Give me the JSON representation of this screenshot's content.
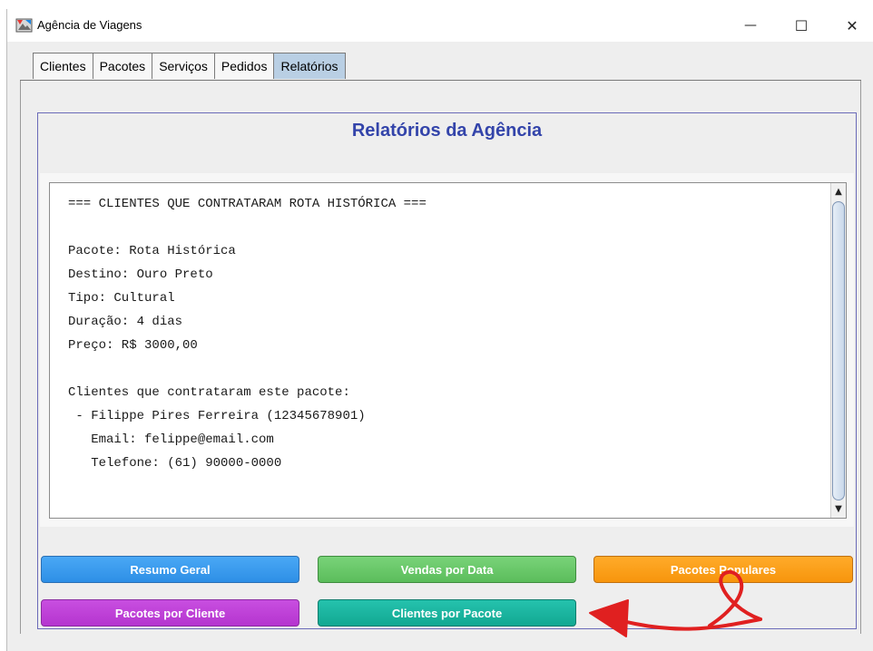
{
  "window": {
    "title": "Agência de Viagens",
    "minimize_glyph": "—",
    "maximize_glyph": "☐",
    "close_glyph": "✕",
    "icon": "app-icon"
  },
  "tabs": [
    {
      "label": "Clientes",
      "active": false
    },
    {
      "label": "Pacotes",
      "active": false
    },
    {
      "label": "Serviços",
      "active": false
    },
    {
      "label": "Pedidos",
      "active": false
    },
    {
      "label": "Relatórios",
      "active": true
    }
  ],
  "panel": {
    "title": "Relatórios da Agência"
  },
  "report": {
    "lines": [
      "=== CLIENTES QUE CONTRATARAM ROTA HISTÓRICA ===",
      "",
      "Pacote: Rota Histórica",
      "Destino: Ouro Preto",
      "Tipo: Cultural",
      "Duração: 4 dias",
      "Preço: R$ 3000,00",
      "",
      "Clientes que contrataram este pacote:",
      " - Filippe Pires Ferreira (12345678901)",
      "   Email: felippe@email.com",
      "   Telefone: (61) 90000-0000"
    ],
    "scroll_up": "▲",
    "scroll_down": "▼"
  },
  "buttons": {
    "resumo_geral": "Resumo Geral",
    "vendas_por_data": "Vendas por Data",
    "pacotes_populares": "Pacotes Populares",
    "pacotes_por_cliente": "Pacotes por Cliente",
    "clientes_por_pacote": "Clientes por Pacote"
  },
  "colors": {
    "title_blue": "#3344aa",
    "active_tab": "#b9cfe4",
    "btn_blue": "#2d8fe6",
    "btn_green": "#5bbd5b",
    "btn_orange": "#f7950c",
    "btn_purple": "#b535cf",
    "btn_teal": "#12a892",
    "annotation_red": "#e02020"
  }
}
